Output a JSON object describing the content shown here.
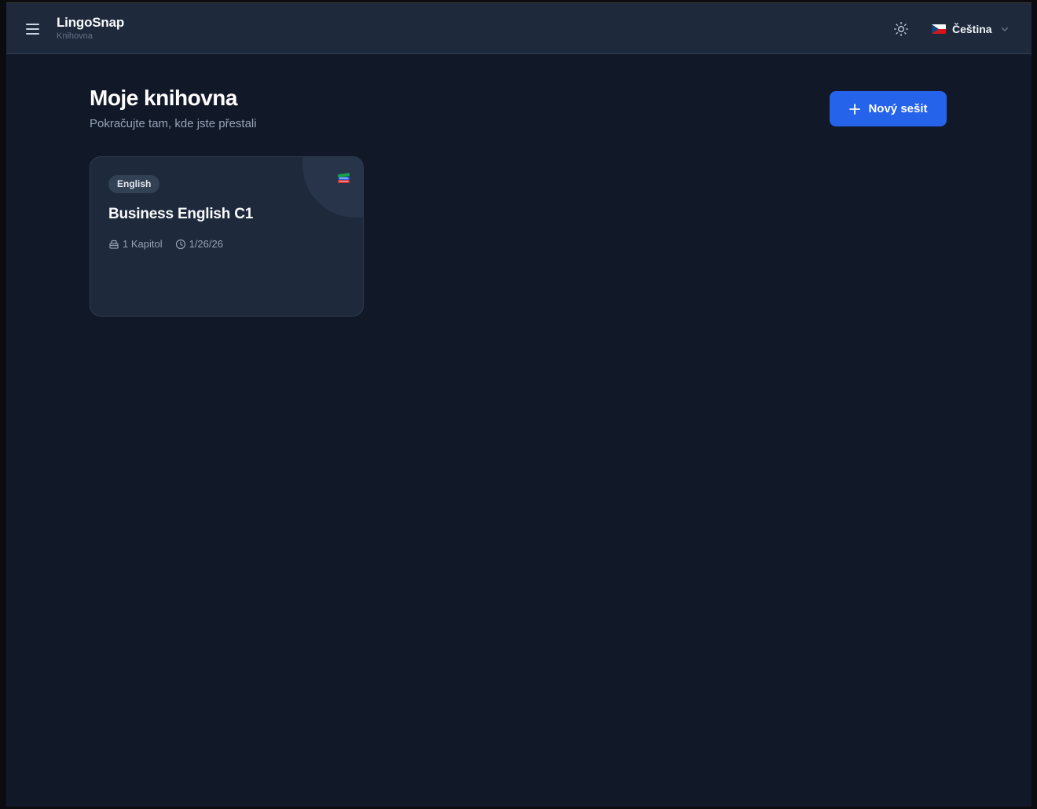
{
  "header": {
    "app_name": "LingoSnap",
    "section": "Knihovna",
    "language": "Čeština"
  },
  "main": {
    "title": "Moje knihovna",
    "subtitle": "Pokračujte tam, kde jste přestali",
    "new_button_label": "Nový sešit"
  },
  "notebooks": [
    {
      "tag": "English",
      "title": "Business English C1",
      "chapters": "1 Kapitol",
      "date": "1/26/26",
      "emoji": "books-icon"
    }
  ],
  "colors": {
    "accent": "#2563eb",
    "background": "#111827",
    "card": "#1e293b"
  }
}
